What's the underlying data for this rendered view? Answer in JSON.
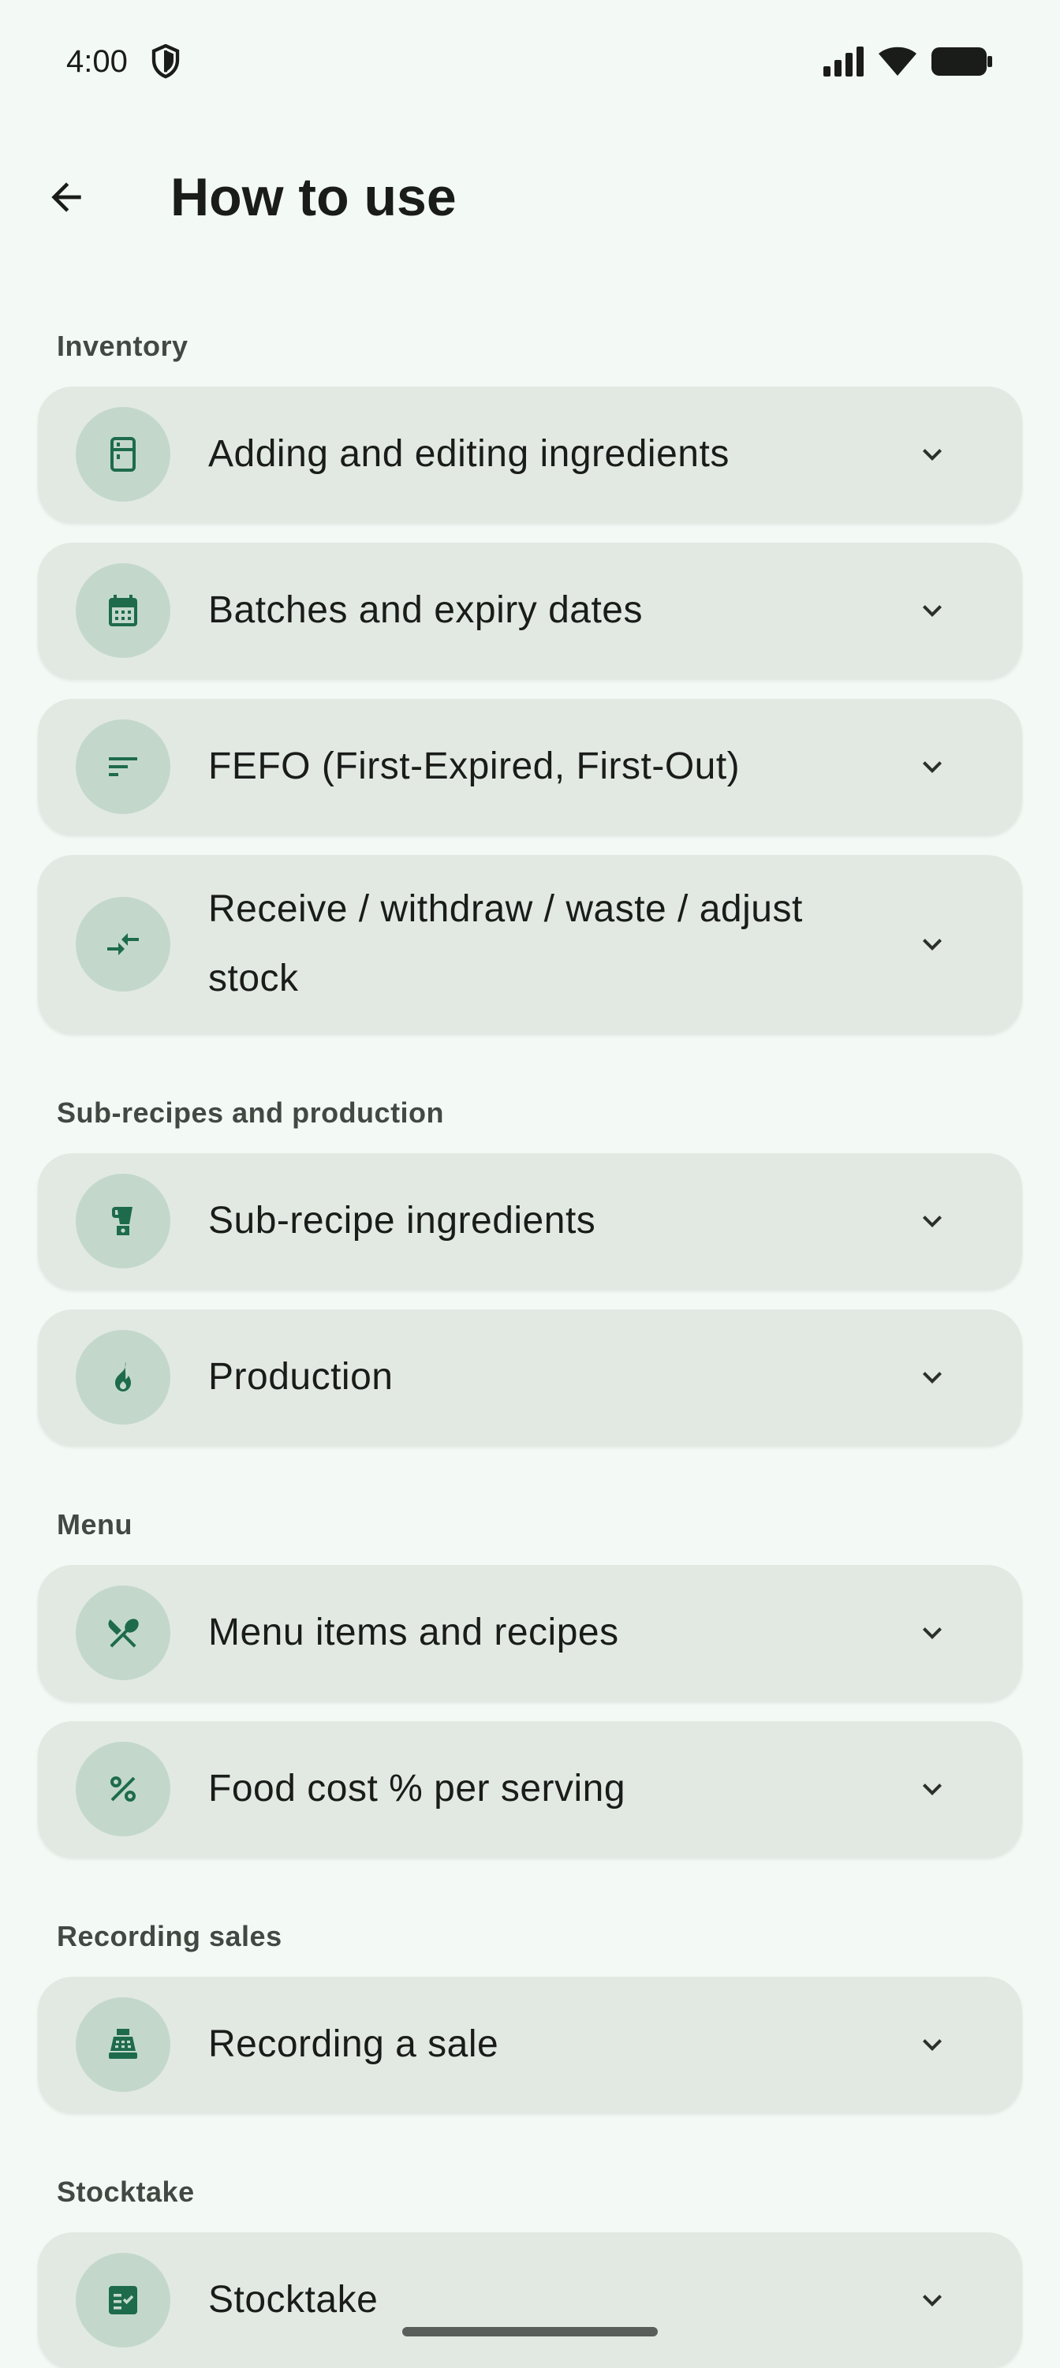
{
  "status_bar": {
    "time": "4:00"
  },
  "app_bar": {
    "title": "How to use"
  },
  "sections": [
    {
      "header": "Inventory",
      "items": [
        {
          "title": "Adding and editing ingredients",
          "icon": "fridge-icon"
        },
        {
          "title": "Batches and expiry dates",
          "icon": "calendar-icon"
        },
        {
          "title": "FEFO (First-Expired, First-Out)",
          "icon": "sort-icon"
        },
        {
          "title": "Receive / withdraw / waste / adjust stock",
          "icon": "compare-arrows-icon"
        }
      ]
    },
    {
      "header": "Sub-recipes and production",
      "items": [
        {
          "title": "Sub-recipe ingredients",
          "icon": "blender-icon"
        },
        {
          "title": "Production",
          "icon": "flame-icon"
        }
      ]
    },
    {
      "header": "Menu",
      "items": [
        {
          "title": "Menu items and recipes",
          "icon": "restaurant-icon"
        },
        {
          "title": "Food cost % per serving",
          "icon": "percent-icon"
        }
      ]
    },
    {
      "header": "Recording sales",
      "items": [
        {
          "title": "Recording a sale",
          "icon": "cash-register-icon"
        }
      ]
    },
    {
      "header": "Stocktake",
      "items": [
        {
          "title": "Stocktake",
          "icon": "checklist-icon"
        }
      ]
    }
  ],
  "colors": {
    "background": "#f3f9f4",
    "card": "#e2e9e3",
    "icon_circle": "#c3d8cb",
    "icon_fg": "#1e6b4c"
  }
}
